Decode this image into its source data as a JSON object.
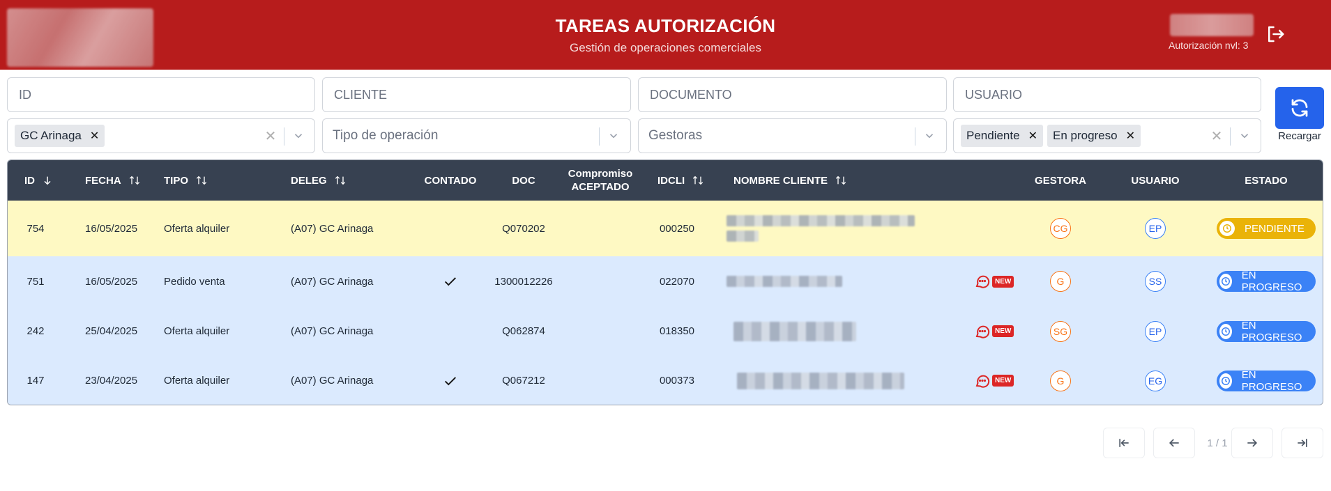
{
  "header": {
    "title": "TAREAS AUTORIZACIÓN",
    "subtitle": "Gestión de operaciones comerciales",
    "auth_level": "Autorización nvl: 3"
  },
  "filters": {
    "id_placeholder": "ID",
    "cliente_placeholder": "CLIENTE",
    "documento_placeholder": "DOCUMENTO",
    "usuario_placeholder": "USUARIO",
    "delegacion_chips": [
      "GC Arinaga"
    ],
    "tipo_placeholder": "Tipo de operación",
    "gestoras_placeholder": "Gestoras",
    "estado_chips": [
      "Pendiente",
      "En progreso"
    ],
    "reload_label": "Recargar"
  },
  "table": {
    "headers": {
      "id": "ID",
      "fecha": "FECHA",
      "tipo": "TIPO",
      "deleg": "DELEG",
      "contado": "CONTADO",
      "doc": "DOC",
      "compromiso_1": "Compromiso",
      "compromiso_2": "ACEPTADO",
      "idcli": "IDCLI",
      "nombre": "NOMBRE CLIENTE",
      "gestora": "GESTORA",
      "usuario": "USUARIO",
      "estado": "ESTADO"
    },
    "new_badge": "NEW",
    "rows": [
      {
        "id": "754",
        "fecha": "16/05/2025",
        "tipo": "Oferta alquiler",
        "deleg": "(A07) GC Arinaga",
        "contado": false,
        "doc": "Q070202",
        "idcli": "000250",
        "has_new": false,
        "gestora": "CG",
        "usuario": "EP",
        "estado": "PENDIENTE"
      },
      {
        "id": "751",
        "fecha": "16/05/2025",
        "tipo": "Pedido venta",
        "deleg": "(A07) GC Arinaga",
        "contado": true,
        "doc": "1300012226",
        "idcli": "022070",
        "has_new": true,
        "gestora": "G",
        "usuario": "SS",
        "estado": "EN PROGRESO"
      },
      {
        "id": "242",
        "fecha": "25/04/2025",
        "tipo": "Oferta alquiler",
        "deleg": "(A07) GC Arinaga",
        "contado": false,
        "doc": "Q062874",
        "idcli": "018350",
        "has_new": true,
        "gestora": "SG",
        "usuario": "EP",
        "estado": "EN PROGRESO"
      },
      {
        "id": "147",
        "fecha": "23/04/2025",
        "tipo": "Oferta alquiler",
        "deleg": "(A07) GC Arinaga",
        "contado": true,
        "doc": "Q067212",
        "idcli": "000373",
        "has_new": true,
        "gestora": "G",
        "usuario": "EG",
        "estado": "EN PROGRESO"
      }
    ]
  },
  "pagination": {
    "info": "1 / 1"
  },
  "colors": {
    "header_bg": "#b71c1c",
    "table_head": "#374151",
    "pending": "#eab308",
    "in_progress": "#3b82f6",
    "row_pending_bg": "#fef9c3",
    "row_progress_bg": "#dbeafe"
  }
}
